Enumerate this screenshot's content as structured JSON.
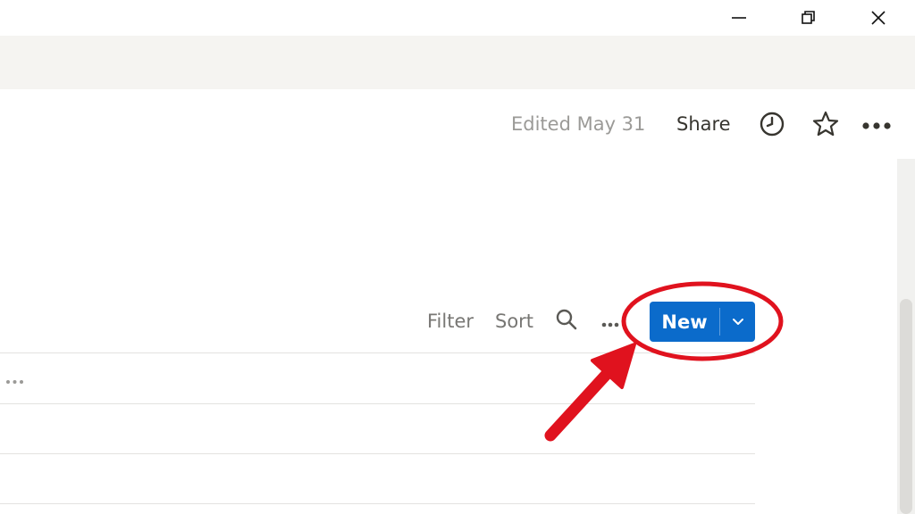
{
  "window_controls": {
    "minimize_icon": "minimize-icon",
    "restore_icon": "restore-icon",
    "close_icon": "close-icon"
  },
  "topbar": {
    "edited_text": "Edited May 31",
    "share_label": "Share",
    "icons": [
      "clock-icon",
      "star-icon",
      "more-horizontal-icon"
    ]
  },
  "database_toolbar": {
    "filter_label": "Filter",
    "sort_label": "Sort",
    "search_icon": "search-icon",
    "more_icon": "more-horizontal-icon",
    "new_button_label": "New",
    "new_dropdown_icon": "chevron-down-icon"
  },
  "table": {
    "header_more_icon": "more-horizontal-icon"
  },
  "colors": {
    "accent_blue": "#0b6bcb",
    "annotation_red": "#e0121e",
    "band_gray": "#f5f4f1",
    "muted_text": "#9b9a97"
  }
}
